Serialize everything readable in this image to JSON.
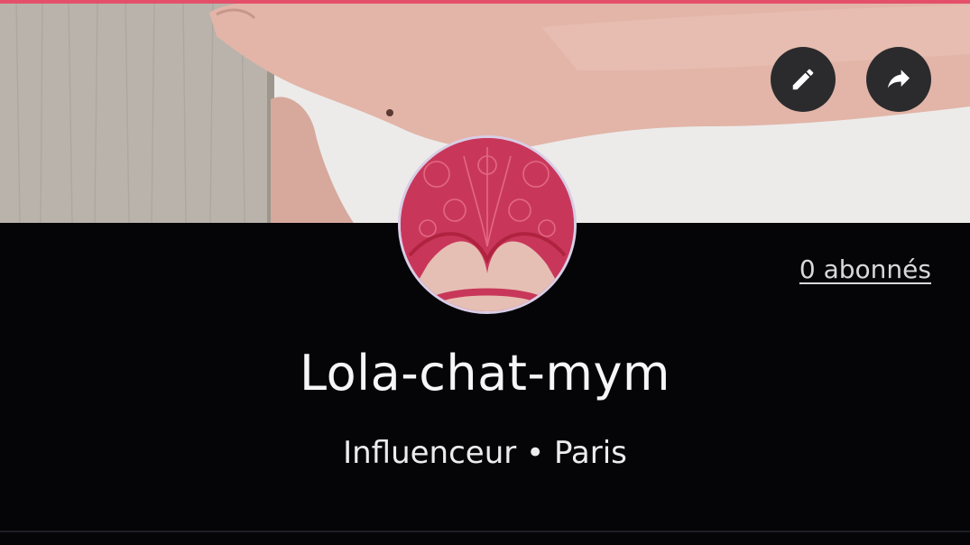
{
  "profile": {
    "username": "Lola-chat-mym",
    "category": "Influenceur",
    "separator": "•",
    "location": "Paris",
    "followers_label": "0 abonnés"
  },
  "actions": {
    "edit_icon": "pencil-icon",
    "share_icon": "share-arrow-icon"
  },
  "colors": {
    "background": "#050508",
    "accent": "#e4506a",
    "button_bg": "#2b2b2e",
    "avatar_border": "#d9cde6"
  }
}
